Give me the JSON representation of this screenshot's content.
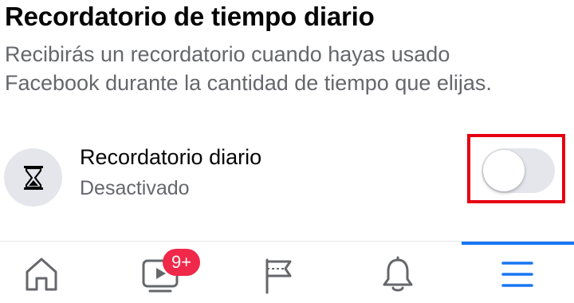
{
  "section": {
    "title": "Recordatorio de tiempo diario",
    "description": "Recibirás un recordatorio cuando hayas usado Facebook durante la cantidad de tiempo que elijas."
  },
  "setting": {
    "icon": "hourglass-icon",
    "label": "Recordatorio diario",
    "status": "Desactivado",
    "toggle_on": false
  },
  "tabbar": {
    "items": [
      {
        "icon": "home-icon",
        "active": false
      },
      {
        "icon": "watch-video-icon",
        "active": false,
        "badge": "9+"
      },
      {
        "icon": "pages-flag-icon",
        "active": false
      },
      {
        "icon": "notifications-bell-icon",
        "active": false
      },
      {
        "icon": "menu-icon",
        "active": true
      }
    ]
  },
  "colors": {
    "accent": "#1877f2",
    "badge": "#f02849",
    "highlight": "#e60012",
    "secondary_text": "#65676b",
    "toggle_track_off": "#e4e6eb"
  }
}
